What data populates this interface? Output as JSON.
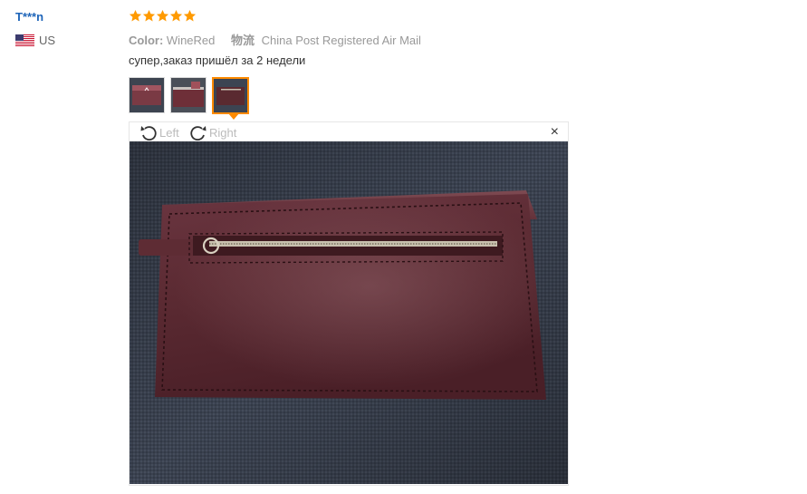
{
  "user": {
    "name": "T***n",
    "country": "US"
  },
  "rating": {
    "stars": 5,
    "max": 5
  },
  "meta": {
    "color_label": "Color:",
    "color_value": "WineRed",
    "shipping_label": "物流",
    "shipping_value": "China Post Registered Air Mail"
  },
  "review_text": "супер,заказ пришёл за 2 недели",
  "thumbnails": {
    "count": 3,
    "active_index": 2
  },
  "viewer": {
    "rotate_left_label": "Left",
    "rotate_right_label": "Right",
    "close_symbol": "×"
  },
  "colors": {
    "username": "#1d64b9",
    "star": "#ff9a00",
    "active_border": "#ff8a00",
    "wallet": "#5a2a30"
  },
  "icons": [
    "us-flag-icon",
    "star-icon",
    "rotate-left-icon",
    "rotate-right-icon",
    "close-icon"
  ]
}
